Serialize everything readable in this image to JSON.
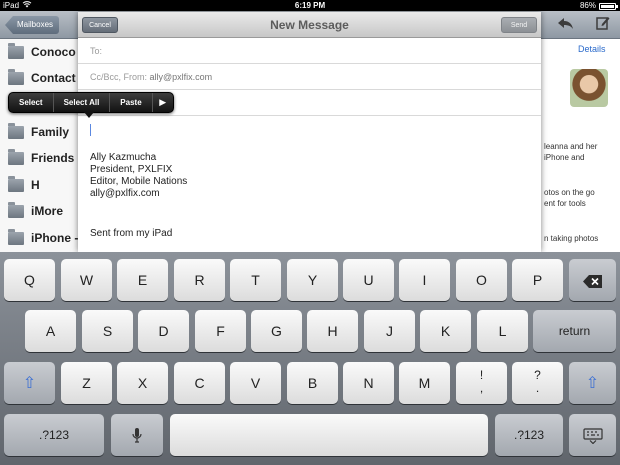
{
  "status_bar": {
    "carrier": "iPad",
    "wifi_icon": "wifi-icon",
    "time": "6:19 PM",
    "battery_percent": "86%",
    "battery_level": 0.86
  },
  "background_app": {
    "back_button": "Mailboxes",
    "toolbar_icons": [
      "reply-icon",
      "compose-icon"
    ],
    "folders": [
      "Conoco",
      "Contact",
      "Family",
      "Friends",
      "H",
      "iMore",
      "iPhone -"
    ],
    "details_link": "Details",
    "snippets": [
      "leanna and her",
      "iPhone and",
      "otos on the go",
      "ent for tools",
      "n taking photos"
    ]
  },
  "compose": {
    "cancel": "Cancel",
    "title": "New Message",
    "send": "Send",
    "to_label": "To:",
    "cc_label": "Cc/Bcc, From:",
    "from_value": "ally@pxlfix.com",
    "signature": [
      "Ally Kazmucha",
      "President, PXLFIX",
      "Editor, Mobile Nations",
      "ally@pxlfix.com"
    ],
    "sent_from": "Sent from my iPad"
  },
  "edit_menu": {
    "items": [
      "Select",
      "Select All",
      "Paste"
    ],
    "more_icon": "play-arrow-icon"
  },
  "keyboard": {
    "row1": [
      "Q",
      "W",
      "E",
      "R",
      "T",
      "Y",
      "U",
      "I",
      "O",
      "P"
    ],
    "backspace_icon": "backspace-icon",
    "row2": [
      "A",
      "S",
      "D",
      "F",
      "G",
      "H",
      "J",
      "K",
      "L"
    ],
    "return": "return",
    "shift_icon": "shift-icon",
    "row3": [
      "Z",
      "X",
      "C",
      "V",
      "B",
      "N",
      "M"
    ],
    "exclaim_top": "!",
    "exclaim_bottom": ",",
    "question_top": "?",
    "question_bottom": ".",
    "numbers": ".?123",
    "mic_icon": "microphone-icon",
    "dismiss_icon": "keyboard-dismiss-icon"
  }
}
